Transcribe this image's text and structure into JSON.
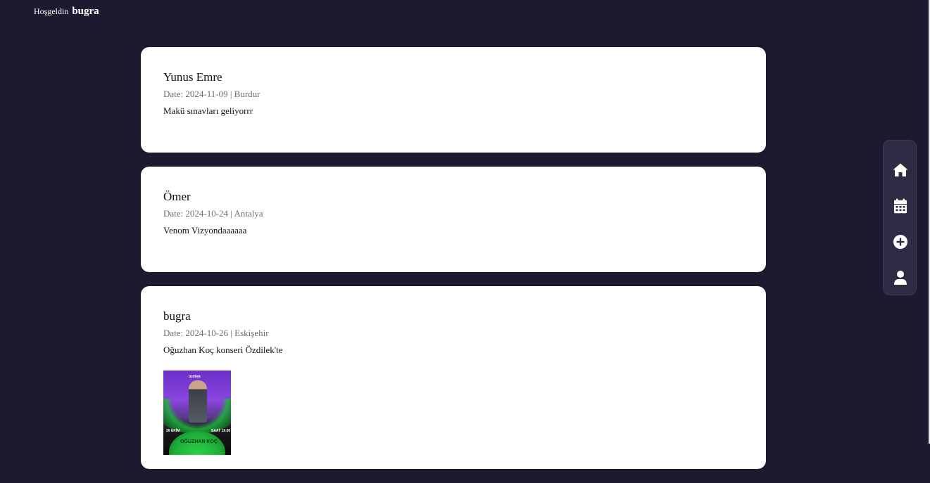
{
  "header": {
    "welcome_text": "Hoşgeldin",
    "username": "bugra"
  },
  "posts": [
    {
      "author": "Yunus Emre",
      "meta": "Date: 2024-11-09 | Burdur",
      "content": "Makü sınavları geliyorrr"
    },
    {
      "author": "Ömer",
      "meta": "Date: 2024-10-24 | Antalya",
      "content": "Venom Vizyondaaaaaa"
    },
    {
      "author": "bugra",
      "meta": "Date: 2024-10-26 | Eskişehir",
      "content": "Oğuzhan Koç konseri Özdilek'te",
      "image": {
        "top_text": "özdilek",
        "left_text": "26 EKİM",
        "right_text": "SAAT 19.00",
        "bottom_text": "OĞUZHAN KOÇ"
      }
    }
  ],
  "sidebar": {
    "items": [
      {
        "icon": "home-icon"
      },
      {
        "icon": "calendar-icon"
      },
      {
        "icon": "add-circle-icon"
      },
      {
        "icon": "user-icon"
      }
    ]
  },
  "colors": {
    "background": "#1b1a2e",
    "card": "#ffffff",
    "sidebar": "#2d2c44",
    "meta_text": "#6b6e7a"
  }
}
